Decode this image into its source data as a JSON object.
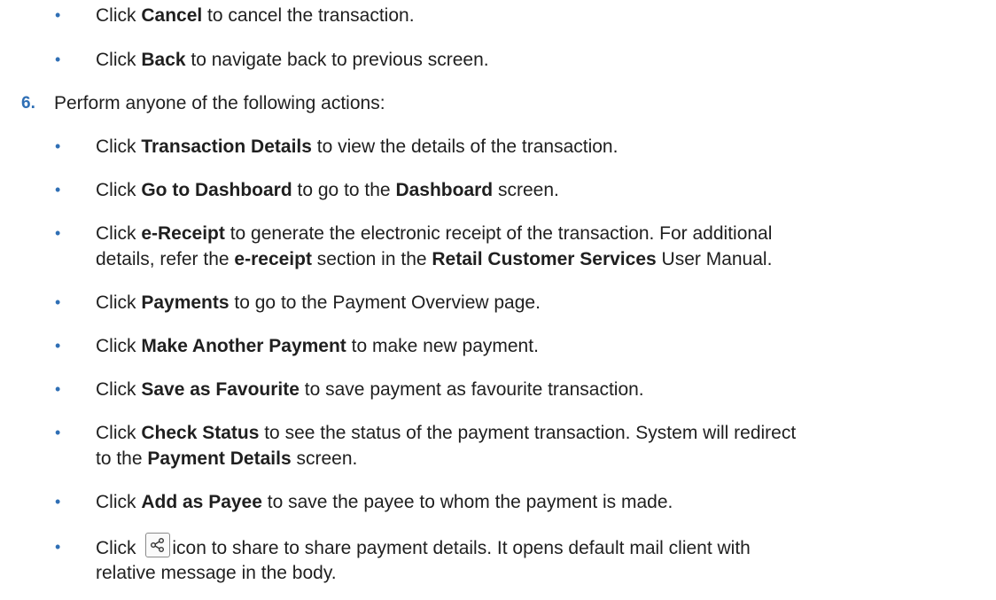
{
  "sub_items_top": [
    {
      "pre": "Click ",
      "bold": "Cancel",
      "post": " to cancel the transaction."
    },
    {
      "pre": "Click ",
      "bold": "Back",
      "post": " to navigate back to previous screen."
    }
  ],
  "step": {
    "number": "6.",
    "text": "Perform anyone of the following actions:"
  },
  "actions": {
    "transaction_details": {
      "pre": "Click ",
      "bold": "Transaction Details",
      "post": " to view the details of the transaction."
    },
    "dashboard": {
      "pre": "Click ",
      "bold": "Go to Dashboard",
      "mid": " to go to the ",
      "bold2": "Dashboard",
      "post": " screen."
    },
    "ereceipt": {
      "pre": "Click ",
      "bold": "e-Receipt",
      "post": " to generate the electronic receipt of the transaction. For additional",
      "line2_pre": "details, refer the ",
      "line2_bold": "e-receipt",
      "line2_mid": " section in the ",
      "line2_bold2": "Retail Customer Services",
      "line2_post": " User Manual."
    },
    "payments": {
      "pre": "Click ",
      "bold": "Payments",
      "post": " to go to the Payment Overview page."
    },
    "another_payment": {
      "pre": "Click ",
      "bold": "Make Another Payment",
      "post": " to make new payment."
    },
    "favourite": {
      "pre": "Click ",
      "bold": "Save as Favourite",
      "post": " to save payment as favourite transaction."
    },
    "check_status": {
      "pre": "Click ",
      "bold": "Check Status",
      "post": " to see the status of the payment transaction. System will redirect",
      "line2_pre": "to the ",
      "line2_bold": "Payment Details",
      "line2_post": " screen."
    },
    "add_payee": {
      "pre": "Click ",
      "bold": "Add as Payee",
      "post": " to save the payee to whom the payment is made."
    },
    "share": {
      "pre": "Click ",
      "icon": "share-icon",
      "post": "icon to share to share payment details. It opens default mail client with",
      "line2": "relative message in the body."
    }
  },
  "bullet_char": "•",
  "colors": {
    "accent": "#2f6fb5",
    "text": "#1f1f1f"
  }
}
